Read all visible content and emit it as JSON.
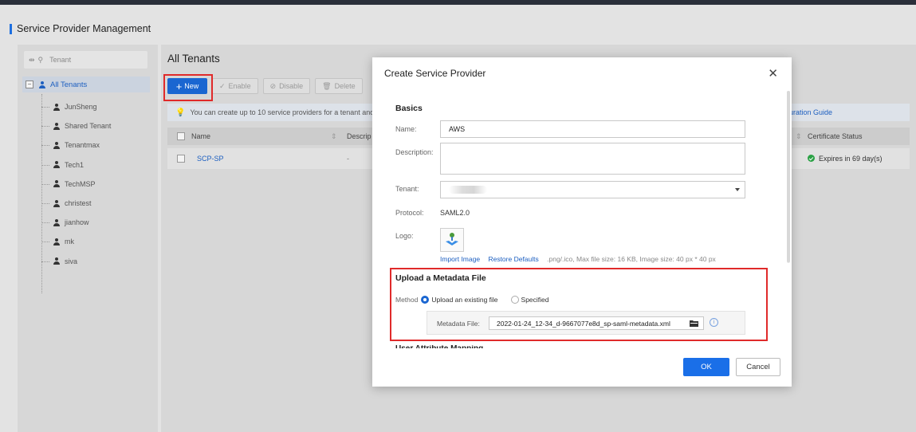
{
  "page": {
    "title": "Service Provider Management"
  },
  "tree": {
    "search_placeholder": "Tenant",
    "root_label": "All Tenants",
    "items": [
      "JunSheng",
      "Shared Tenant",
      "Tenantmax",
      "Tech1",
      "TechMSP",
      "christest",
      "jianhow",
      "mk",
      "siva"
    ]
  },
  "main": {
    "title": "All Tenants",
    "toolbar": {
      "new": "New",
      "enable": "Enable",
      "disable": "Disable",
      "delete": "Delete"
    },
    "notice": "You can create up to 10 service providers for a tenant and",
    "guide_link": "uration Guide",
    "table": {
      "headers": {
        "name": "Name",
        "description": "Descrip",
        "certificate_status": "Certificate Status"
      },
      "rows": [
        {
          "name": "SCP-SP",
          "description": "-",
          "certificate_status": "Expires in 69 day(s)"
        }
      ]
    }
  },
  "modal": {
    "title": "Create Service Provider",
    "basics": {
      "title": "Basics",
      "name_label": "Name:",
      "name_value": "AWS",
      "description_label": "Description:",
      "description_value": "",
      "tenant_label": "Tenant:",
      "protocol_label": "Protocol:",
      "protocol_value": "SAML2.0",
      "logo_label": "Logo:",
      "import_image": "Import Image",
      "restore_defaults": "Restore Defaults",
      "logo_hint": ".png/.ico, Max file size: 16 KB, Image size: 40 px * 40 px"
    },
    "upload": {
      "title": "Upload a Metadata File",
      "method_label": "Method",
      "option_existing": "Upload an existing file",
      "option_specified": "Specified",
      "metadata_label": "Metadata File:",
      "metadata_value": "2022-01-24_12-34_d-9667077e8d_sp-saml-metadata.xml"
    },
    "cut_section": "User Attribute Mapping",
    "ok": "OK",
    "cancel": "Cancel"
  }
}
